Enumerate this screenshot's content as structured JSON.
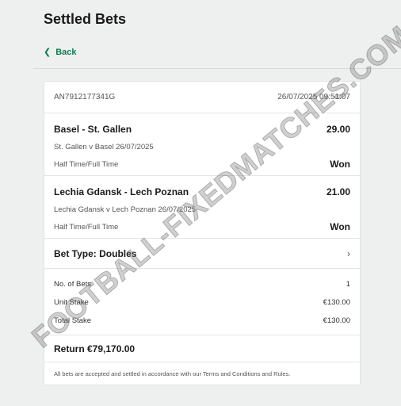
{
  "header": {
    "title": "Settled Bets",
    "back_label": "Back"
  },
  "bet": {
    "reference": "AN7912177341G",
    "datetime": "26/07/2025 09:51:07",
    "selections": [
      {
        "name": "Basel - St. Gallen",
        "odds": "29.00",
        "event": "St. Gallen v Basel 26/07/2025",
        "market": "Half Time/Full Time",
        "result": "Won"
      },
      {
        "name": "Lechia Gdansk - Lech Poznan",
        "odds": "21.00",
        "event": "Lechia Gdansk v Lech Poznan 26/07/2025",
        "market": "Half Time/Full Time",
        "result": "Won"
      }
    ],
    "bet_type": "Bet Type: Doubles",
    "stakes": {
      "num_bets_label": "No. of Bets",
      "num_bets_value": "1",
      "unit_stake_label": "Unit Stake",
      "unit_stake_value": "€130.00",
      "total_stake_label": "Total Stake",
      "total_stake_value": "€130.00"
    },
    "return_text": "Return €79,170.00",
    "terms": "All bets are accepted and settled in accordance with our Terms and Conditions and Rules."
  },
  "watermark": "FOOTBALL-FIXEDMATCHES.COM",
  "icons": {
    "back": "chevron-left-icon",
    "bet_type": "chevron-right-icon"
  }
}
